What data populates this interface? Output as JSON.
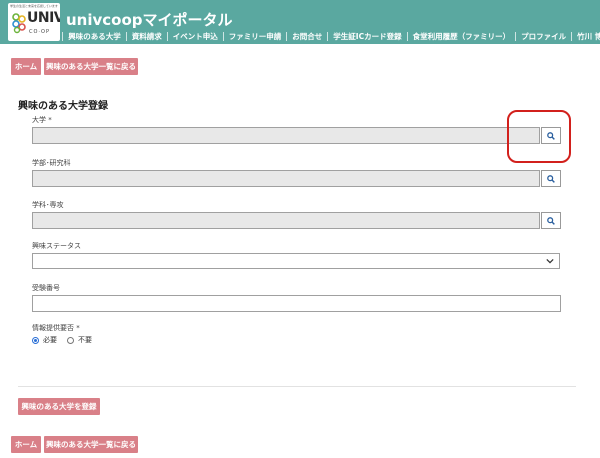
{
  "header": {
    "logo_tagline": "学生の生活と未来を応援しています",
    "logo_word": "UNIV.",
    "logo_sub": "CO·OP",
    "app_title": "univcoopマイポータル",
    "nav": [
      "ホーム",
      "興味のある大学",
      "資料請求",
      "イベント申込",
      "ファミリー申請",
      "お問合せ",
      "学生証ICカード登録",
      "食堂利用履歴（ファミリー）",
      "プロファイル"
    ],
    "user_name": "竹川 博士"
  },
  "top_buttons": {
    "home": "ホーム",
    "back_to_list": "興味のある大学一覧に戻る"
  },
  "form": {
    "title": "興味のある大学登録",
    "university_label": "大学",
    "university_required": "*",
    "university_value": "",
    "faculty_label": "学部･研究科",
    "faculty_value": "",
    "department_label": "学科･専攻",
    "department_value": "",
    "interest_status_label": "興味ステータス",
    "interest_status_value": "",
    "exam_number_label": "受験番号",
    "exam_number_value": "",
    "info_label": "情報提供要否",
    "info_required": "*",
    "info_options": [
      "必要",
      "不要"
    ],
    "info_selected": "必要",
    "search_icon": "search-icon",
    "submit_label": "興味のある大学を登録"
  },
  "bottom_buttons": {
    "home": "ホーム",
    "back_to_list": "興味のある大学一覧に戻る"
  },
  "colors": {
    "header_bg": "#5aa8a0",
    "button_bg": "#d98088",
    "highlight": "#d2201c",
    "radio_accent": "#2a6fd6"
  }
}
